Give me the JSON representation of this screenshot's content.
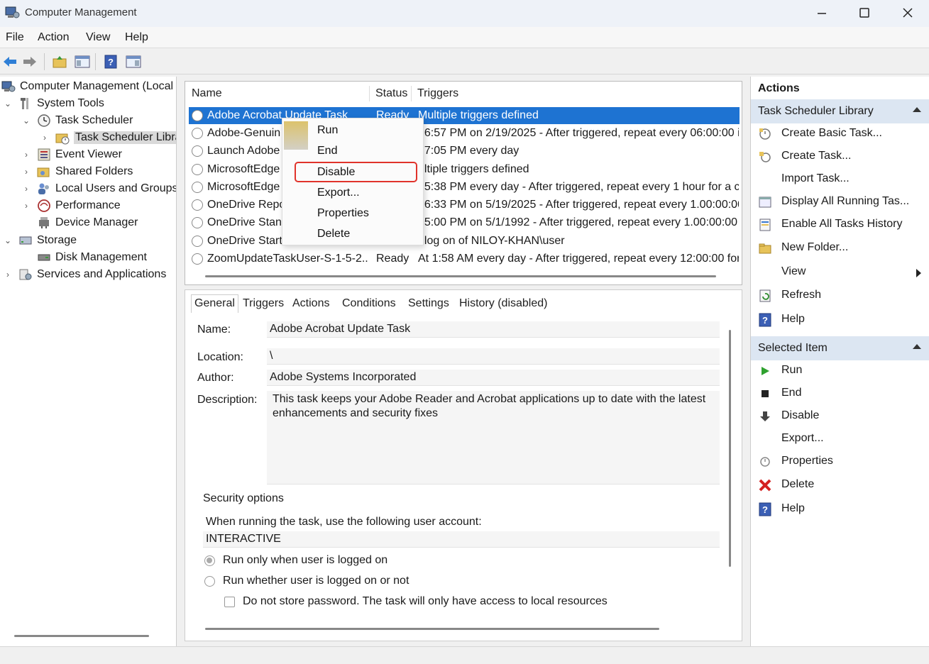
{
  "window": {
    "title": "Computer Management"
  },
  "menu": [
    "File",
    "Action",
    "View",
    "Help"
  ],
  "toolbar": {
    "icons": [
      "back-arrow-icon",
      "forward-arrow-icon",
      "up-folder-icon",
      "console-tree-icon",
      "help-icon",
      "action-pane-icon"
    ]
  },
  "tree": [
    {
      "label": "Computer Management (Local",
      "icon": "computer-management-icon"
    },
    {
      "label": "System Tools",
      "icon": "tools-icon"
    },
    {
      "label": "Task Scheduler",
      "icon": "clock-icon"
    },
    {
      "label": "Task Scheduler Libra",
      "icon": "folder-clock-icon"
    },
    {
      "label": "Event Viewer",
      "icon": "event-viewer-icon"
    },
    {
      "label": "Shared Folders",
      "icon": "shared-folders-icon"
    },
    {
      "label": "Local Users and Groups",
      "icon": "users-icon"
    },
    {
      "label": "Performance",
      "icon": "performance-icon"
    },
    {
      "label": "Device Manager",
      "icon": "device-manager-icon"
    },
    {
      "label": "Storage",
      "icon": "storage-icon"
    },
    {
      "label": "Disk Management",
      "icon": "disk-icon"
    },
    {
      "label": "Services and Applications",
      "icon": "services-icon"
    }
  ],
  "tasklist": {
    "columns": [
      "Name",
      "Status",
      "Triggers"
    ],
    "rows": [
      {
        "name": "Adobe Acrobat Update Task",
        "status": "Ready",
        "triggers": "Multiple triggers defined"
      },
      {
        "name": "Adobe-Genuin",
        "status": "",
        "triggers": "t 6:57 PM on 2/19/2025 - After triggered, repeat every 06:00:00 i"
      },
      {
        "name": "Launch Adobe",
        "status": "",
        "triggers": "t 7:05 PM every day"
      },
      {
        "name": "MicrosoftEdge",
        "status": "",
        "triggers": "ultiple triggers defined"
      },
      {
        "name": "MicrosoftEdge",
        "status": "",
        "triggers": "t 5:38 PM every day - After triggered, repeat every 1 hour for a c"
      },
      {
        "name": "OneDrive Repo",
        "status": "",
        "triggers": "t 6:33 PM on 5/19/2025 - After triggered, repeat every 1.00:00:00"
      },
      {
        "name": "OneDrive Stanc",
        "status": "",
        "triggers": "t 5:00 PM on 5/1/1992 - After triggered, repeat every 1.00:00:00"
      },
      {
        "name": "OneDrive Start",
        "status": "",
        "triggers": "t log on of NILOY-KHAN\\user"
      },
      {
        "name": "ZoomUpdateTaskUser-S-1-5-2...",
        "status": "Ready",
        "triggers": "At 1:58 AM every day - After triggered, repeat every 12:00:00 for a"
      }
    ]
  },
  "context_menu": {
    "items": [
      "Run",
      "End",
      "Disable",
      "Export...",
      "Properties",
      "Delete"
    ],
    "highlighted": "Disable"
  },
  "details": {
    "tabs": [
      "General",
      "Triggers",
      "Actions",
      "Conditions",
      "Settings",
      "History (disabled)"
    ],
    "name_label": "Name:",
    "name_value": "Adobe Acrobat Update Task",
    "location_label": "Location:",
    "location_value": "\\",
    "author_label": "Author:",
    "author_value": "Adobe Systems Incorporated",
    "description_label": "Description:",
    "description_value": "This task keeps your Adobe Reader and Acrobat applications up to date with the latest enhancements and security fixes",
    "security_heading": "Security options",
    "account_prompt": "When running the task, use the following user account:",
    "account_value": "INTERACTIVE",
    "radio1": "Run only when user is logged on",
    "radio2": "Run whether user is logged on or not",
    "checkbox": "Do not store password.  The task will only have access to local resources"
  },
  "actions": {
    "header": "Actions",
    "group1": "Task Scheduler Library",
    "group1_items": [
      {
        "label": "Create Basic Task...",
        "icon": "create-basic-task-icon"
      },
      {
        "label": "Create Task...",
        "icon": "create-task-icon"
      },
      {
        "label": "Import Task...",
        "icon": ""
      },
      {
        "label": "Display All Running Tas...",
        "icon": "running-tasks-icon"
      },
      {
        "label": "Enable All Tasks History",
        "icon": "history-icon"
      },
      {
        "label": "New Folder...",
        "icon": "new-folder-icon"
      },
      {
        "label": "View",
        "icon": ""
      },
      {
        "label": "Refresh",
        "icon": "refresh-icon"
      },
      {
        "label": "Help",
        "icon": "help-icon"
      }
    ],
    "group2": "Selected Item",
    "group2_items": [
      {
        "label": "Run",
        "icon": "run-icon"
      },
      {
        "label": "End",
        "icon": "end-icon"
      },
      {
        "label": "Disable",
        "icon": "disable-icon"
      },
      {
        "label": "Export...",
        "icon": ""
      },
      {
        "label": "Properties",
        "icon": "properties-icon"
      },
      {
        "label": "Delete",
        "icon": "delete-icon"
      },
      {
        "label": "Help",
        "icon": "help-icon"
      }
    ]
  },
  "colors": {
    "selection": "#1e73d2",
    "highlight_box": "#e0332b",
    "group_header": "#dce6f2"
  }
}
